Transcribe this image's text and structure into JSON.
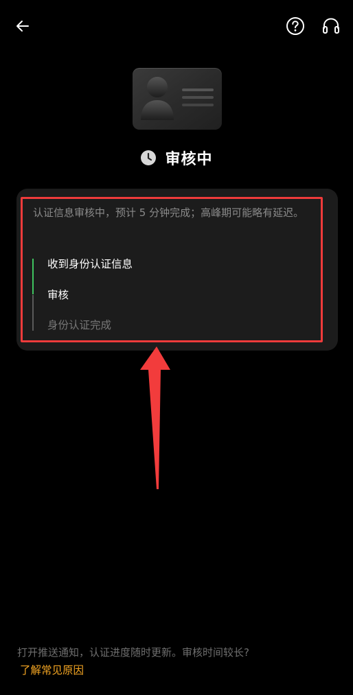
{
  "status": {
    "title": "审核中",
    "icon": "clock-icon"
  },
  "panel": {
    "description": "认证信息审核中，预计 5 分钟完成；高峰期可能略有延迟。",
    "steps": [
      {
        "label": "收到身份认证信息",
        "state": "done"
      },
      {
        "label": "审核",
        "state": "current"
      },
      {
        "label": "身份认证完成",
        "state": "pending"
      }
    ]
  },
  "footer": {
    "tip": "打开推送通知，认证进度随时更新。审核时间较长?",
    "link": "了解常见原因"
  },
  "colors": {
    "background": "#000000",
    "panel": "#1c1c1c",
    "progress_done": "#3fc35f",
    "progress_pending": "#5a5a5a",
    "link": "#f5a623",
    "annotation": "#ef3b3b"
  },
  "icons": {
    "back": "back-arrow-icon",
    "help": "help-icon",
    "support": "headset-icon",
    "annotation": "red-arrow-icon"
  }
}
